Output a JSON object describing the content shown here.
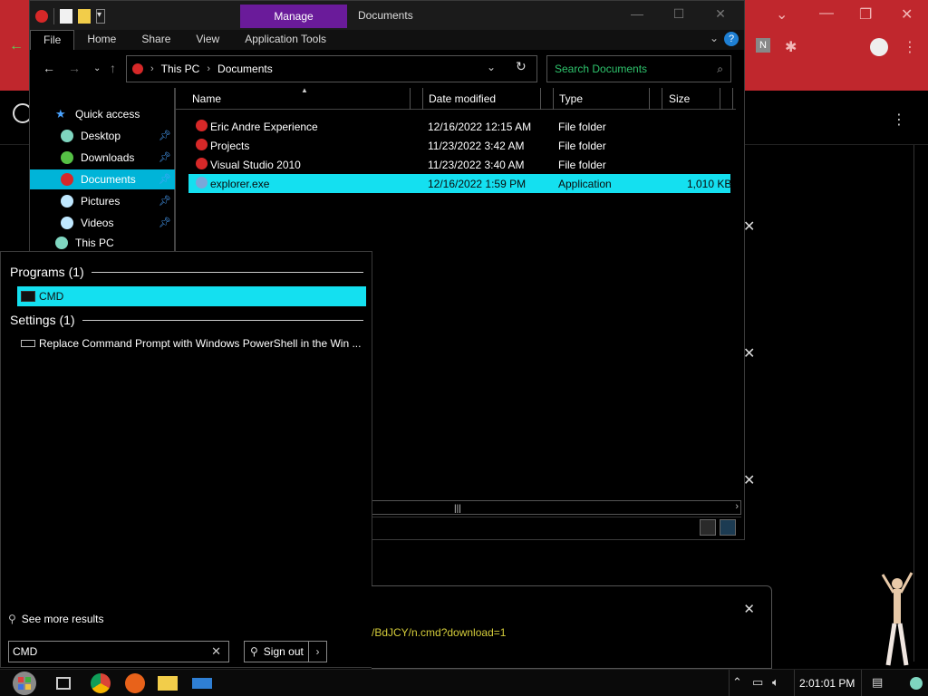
{
  "explorer": {
    "window_title": "Documents",
    "manage_tab": "Manage",
    "ribbon_tabs": [
      "File",
      "Home",
      "Share",
      "View",
      "Application Tools"
    ],
    "breadcrumb": [
      "This PC",
      "Documents"
    ],
    "search_placeholder": "Search Documents",
    "nav_items": [
      {
        "label": "Quick access",
        "icon": "star-icon"
      },
      {
        "label": "Desktop",
        "icon": "desktop-icon"
      },
      {
        "label": "Downloads",
        "icon": "downloads-icon"
      },
      {
        "label": "Documents",
        "icon": "documents-icon"
      },
      {
        "label": "Pictures",
        "icon": "pictures-icon"
      },
      {
        "label": "Videos",
        "icon": "videos-icon"
      },
      {
        "label": "This PC",
        "icon": "pc-icon"
      }
    ],
    "columns": [
      "Name",
      "Date modified",
      "Type",
      "Size"
    ],
    "files": [
      {
        "name": "Eric Andre Experience",
        "date": "12/16/2022 12:15 AM",
        "type": "File folder",
        "size": ""
      },
      {
        "name": "Projects",
        "date": "11/23/2022 3:42 AM",
        "type": "File folder",
        "size": ""
      },
      {
        "name": "Visual Studio 2010",
        "date": "11/23/2022 3:40 AM",
        "type": "File folder",
        "size": ""
      },
      {
        "name": "explorer.exe",
        "date": "12/16/2022 1:59 PM",
        "type": "Application",
        "size": "1,010 KB"
      }
    ]
  },
  "start_search": {
    "programs_header": "Programs (1)",
    "program_result": "CMD",
    "settings_header": "Settings (1)",
    "settings_result": "Replace Command Prompt with Windows PowerShell in the Win ...",
    "see_more": "See more results",
    "query": "CMD",
    "signout": "Sign out"
  },
  "download": {
    "url": "/BdJCY/n.cmd?download=1"
  },
  "taskbar": {
    "clock": "2:01:01 PM"
  },
  "colors": {
    "selection": "#14e0f0",
    "manage_tab": "#6a1b9a",
    "browser_bg": "#c0272d",
    "search_text": "#2ec36c",
    "download_url": "#d4cc3a"
  }
}
